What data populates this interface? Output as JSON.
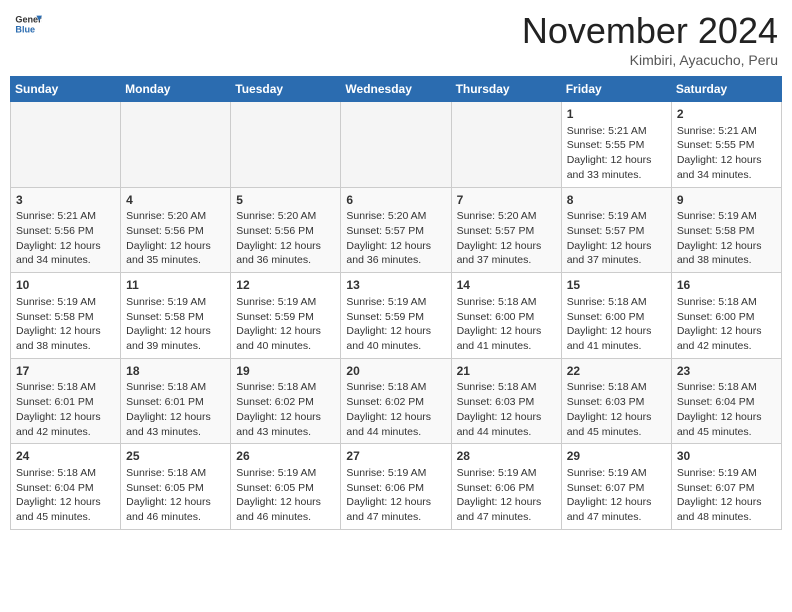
{
  "header": {
    "logo_general": "General",
    "logo_blue": "Blue",
    "month": "November 2024",
    "location": "Kimbiri, Ayacucho, Peru"
  },
  "days_of_week": [
    "Sunday",
    "Monday",
    "Tuesday",
    "Wednesday",
    "Thursday",
    "Friday",
    "Saturday"
  ],
  "weeks": [
    [
      {
        "day": "",
        "info": ""
      },
      {
        "day": "",
        "info": ""
      },
      {
        "day": "",
        "info": ""
      },
      {
        "day": "",
        "info": ""
      },
      {
        "day": "",
        "info": ""
      },
      {
        "day": "1",
        "info": "Sunrise: 5:21 AM\nSunset: 5:55 PM\nDaylight: 12 hours and 33 minutes."
      },
      {
        "day": "2",
        "info": "Sunrise: 5:21 AM\nSunset: 5:55 PM\nDaylight: 12 hours and 34 minutes."
      }
    ],
    [
      {
        "day": "3",
        "info": "Sunrise: 5:21 AM\nSunset: 5:56 PM\nDaylight: 12 hours and 34 minutes."
      },
      {
        "day": "4",
        "info": "Sunrise: 5:20 AM\nSunset: 5:56 PM\nDaylight: 12 hours and 35 minutes."
      },
      {
        "day": "5",
        "info": "Sunrise: 5:20 AM\nSunset: 5:56 PM\nDaylight: 12 hours and 36 minutes."
      },
      {
        "day": "6",
        "info": "Sunrise: 5:20 AM\nSunset: 5:57 PM\nDaylight: 12 hours and 36 minutes."
      },
      {
        "day": "7",
        "info": "Sunrise: 5:20 AM\nSunset: 5:57 PM\nDaylight: 12 hours and 37 minutes."
      },
      {
        "day": "8",
        "info": "Sunrise: 5:19 AM\nSunset: 5:57 PM\nDaylight: 12 hours and 37 minutes."
      },
      {
        "day": "9",
        "info": "Sunrise: 5:19 AM\nSunset: 5:58 PM\nDaylight: 12 hours and 38 minutes."
      }
    ],
    [
      {
        "day": "10",
        "info": "Sunrise: 5:19 AM\nSunset: 5:58 PM\nDaylight: 12 hours and 38 minutes."
      },
      {
        "day": "11",
        "info": "Sunrise: 5:19 AM\nSunset: 5:58 PM\nDaylight: 12 hours and 39 minutes."
      },
      {
        "day": "12",
        "info": "Sunrise: 5:19 AM\nSunset: 5:59 PM\nDaylight: 12 hours and 40 minutes."
      },
      {
        "day": "13",
        "info": "Sunrise: 5:19 AM\nSunset: 5:59 PM\nDaylight: 12 hours and 40 minutes."
      },
      {
        "day": "14",
        "info": "Sunrise: 5:18 AM\nSunset: 6:00 PM\nDaylight: 12 hours and 41 minutes."
      },
      {
        "day": "15",
        "info": "Sunrise: 5:18 AM\nSunset: 6:00 PM\nDaylight: 12 hours and 41 minutes."
      },
      {
        "day": "16",
        "info": "Sunrise: 5:18 AM\nSunset: 6:00 PM\nDaylight: 12 hours and 42 minutes."
      }
    ],
    [
      {
        "day": "17",
        "info": "Sunrise: 5:18 AM\nSunset: 6:01 PM\nDaylight: 12 hours and 42 minutes."
      },
      {
        "day": "18",
        "info": "Sunrise: 5:18 AM\nSunset: 6:01 PM\nDaylight: 12 hours and 43 minutes."
      },
      {
        "day": "19",
        "info": "Sunrise: 5:18 AM\nSunset: 6:02 PM\nDaylight: 12 hours and 43 minutes."
      },
      {
        "day": "20",
        "info": "Sunrise: 5:18 AM\nSunset: 6:02 PM\nDaylight: 12 hours and 44 minutes."
      },
      {
        "day": "21",
        "info": "Sunrise: 5:18 AM\nSunset: 6:03 PM\nDaylight: 12 hours and 44 minutes."
      },
      {
        "day": "22",
        "info": "Sunrise: 5:18 AM\nSunset: 6:03 PM\nDaylight: 12 hours and 45 minutes."
      },
      {
        "day": "23",
        "info": "Sunrise: 5:18 AM\nSunset: 6:04 PM\nDaylight: 12 hours and 45 minutes."
      }
    ],
    [
      {
        "day": "24",
        "info": "Sunrise: 5:18 AM\nSunset: 6:04 PM\nDaylight: 12 hours and 45 minutes."
      },
      {
        "day": "25",
        "info": "Sunrise: 5:18 AM\nSunset: 6:05 PM\nDaylight: 12 hours and 46 minutes."
      },
      {
        "day": "26",
        "info": "Sunrise: 5:19 AM\nSunset: 6:05 PM\nDaylight: 12 hours and 46 minutes."
      },
      {
        "day": "27",
        "info": "Sunrise: 5:19 AM\nSunset: 6:06 PM\nDaylight: 12 hours and 47 minutes."
      },
      {
        "day": "28",
        "info": "Sunrise: 5:19 AM\nSunset: 6:06 PM\nDaylight: 12 hours and 47 minutes."
      },
      {
        "day": "29",
        "info": "Sunrise: 5:19 AM\nSunset: 6:07 PM\nDaylight: 12 hours and 47 minutes."
      },
      {
        "day": "30",
        "info": "Sunrise: 5:19 AM\nSunset: 6:07 PM\nDaylight: 12 hours and 48 minutes."
      }
    ]
  ]
}
